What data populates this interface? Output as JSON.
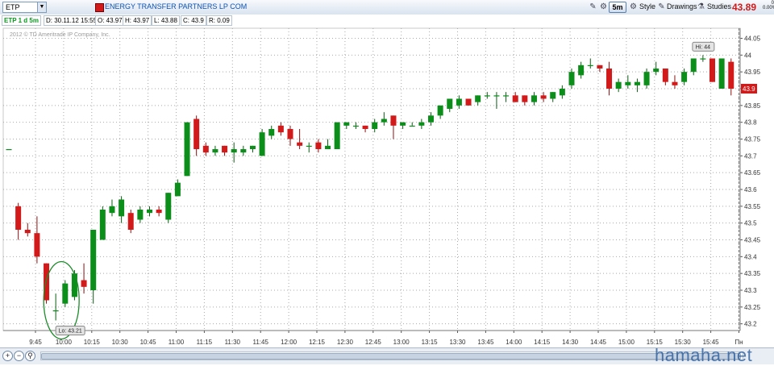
{
  "header": {
    "symbol": "ETP",
    "company": "ENERGY TRANSFER PARTNERS LP COM",
    "interval_label": "5m",
    "style_label": "Style",
    "drawings_label": "Drawings",
    "studies_label": "Studies",
    "last_price": "43.89",
    "change_top": "0",
    "change_pct": "0.00%"
  },
  "infobar": {
    "study": "ETP 1 d 5m",
    "date": "D: 30.11.12 15:55",
    "open": "O: 43.97",
    "high": "H: 43.97",
    "low": "L: 43.88",
    "close": "C: 43.9",
    "range": "R: 0.09"
  },
  "copyright": "2012 © TD Ameritrade IP Company, Inc.",
  "watermark": "hamaha.net",
  "colors": {
    "up": "#0b8e1a",
    "down": "#d21a1a",
    "grid": "#a9a9a9",
    "annotation": "#1c8c2a"
  },
  "chart_data": {
    "type": "candlestick",
    "interval": "5m",
    "y_ticks": [
      "43.2",
      "43.25",
      "43.3",
      "43.35",
      "43.4",
      "43.45",
      "43.5",
      "43.55",
      "43.6",
      "43.65",
      "43.7",
      "43.75",
      "43.8",
      "43.85",
      "43.9",
      "43.95",
      "44",
      "44.05"
    ],
    "ylim": [
      43.18,
      44.08
    ],
    "x_ticks": [
      "9:45",
      "10:00",
      "10:15",
      "10:30",
      "10:45",
      "11:00",
      "11:15",
      "11:30",
      "11:45",
      "12:00",
      "12:15",
      "12:30",
      "12:45",
      "13:00",
      "13:15",
      "13:30",
      "13:45",
      "14:00",
      "14:15",
      "14:30",
      "14:45",
      "15:00",
      "15:15",
      "15:30",
      "15:45",
      "Пн"
    ],
    "last_price_label": "43.9",
    "annotations": {
      "high_label": "Hi: 44",
      "low_label": "Lo: 43.21"
    },
    "candles": [
      {
        "o": 43.72,
        "h": 43.72,
        "l": 43.72,
        "c": 43.72
      },
      {
        "o": 43.55,
        "h": 43.56,
        "l": 43.45,
        "c": 43.48
      },
      {
        "o": 43.48,
        "h": 43.5,
        "l": 43.46,
        "c": 43.47
      },
      {
        "o": 43.47,
        "h": 43.52,
        "l": 43.38,
        "c": 43.4
      },
      {
        "o": 43.38,
        "h": 43.38,
        "l": 43.26,
        "c": 43.27
      },
      {
        "o": 43.24,
        "h": 43.29,
        "l": 43.21,
        "c": 43.24
      },
      {
        "o": 43.26,
        "h": 43.33,
        "l": 43.25,
        "c": 43.32
      },
      {
        "o": 43.28,
        "h": 43.36,
        "l": 43.27,
        "c": 43.35
      },
      {
        "o": 43.33,
        "h": 43.38,
        "l": 43.29,
        "c": 43.31
      },
      {
        "o": 43.3,
        "h": 43.48,
        "l": 43.26,
        "c": 43.48
      },
      {
        "o": 43.45,
        "h": 43.55,
        "l": 43.45,
        "c": 43.54
      },
      {
        "o": 43.53,
        "h": 43.57,
        "l": 43.52,
        "c": 43.55
      },
      {
        "o": 43.52,
        "h": 43.58,
        "l": 43.5,
        "c": 43.57
      },
      {
        "o": 43.53,
        "h": 43.54,
        "l": 43.47,
        "c": 43.48
      },
      {
        "o": 43.51,
        "h": 43.55,
        "l": 43.5,
        "c": 43.54
      },
      {
        "o": 43.53,
        "h": 43.55,
        "l": 43.52,
        "c": 43.54
      },
      {
        "o": 43.54,
        "h": 43.55,
        "l": 43.52,
        "c": 43.53
      },
      {
        "o": 43.51,
        "h": 43.59,
        "l": 43.5,
        "c": 43.59
      },
      {
        "o": 43.58,
        "h": 43.63,
        "l": 43.58,
        "c": 43.62
      },
      {
        "o": 43.64,
        "h": 43.8,
        "l": 43.64,
        "c": 43.8
      },
      {
        "o": 43.81,
        "h": 43.82,
        "l": 43.7,
        "c": 43.72
      },
      {
        "o": 43.73,
        "h": 43.74,
        "l": 43.7,
        "c": 43.71
      },
      {
        "o": 43.71,
        "h": 43.73,
        "l": 43.7,
        "c": 43.72
      },
      {
        "o": 43.73,
        "h": 43.73,
        "l": 43.7,
        "c": 43.71
      },
      {
        "o": 43.71,
        "h": 43.74,
        "l": 43.68,
        "c": 43.72
      },
      {
        "o": 43.71,
        "h": 43.73,
        "l": 43.7,
        "c": 43.72
      },
      {
        "o": 43.72,
        "h": 43.73,
        "l": 43.71,
        "c": 43.73
      },
      {
        "o": 43.7,
        "h": 43.78,
        "l": 43.7,
        "c": 43.77
      },
      {
        "o": 43.76,
        "h": 43.79,
        "l": 43.75,
        "c": 43.78
      },
      {
        "o": 43.79,
        "h": 43.8,
        "l": 43.76,
        "c": 43.77
      },
      {
        "o": 43.78,
        "h": 43.79,
        "l": 43.73,
        "c": 43.75
      },
      {
        "o": 43.74,
        "h": 43.78,
        "l": 43.72,
        "c": 43.73
      },
      {
        "o": 43.73,
        "h": 43.74,
        "l": 43.71,
        "c": 43.73
      },
      {
        "o": 43.74,
        "h": 43.75,
        "l": 43.71,
        "c": 43.72
      },
      {
        "o": 43.72,
        "h": 43.75,
        "l": 43.72,
        "c": 43.73
      },
      {
        "o": 43.72,
        "h": 43.8,
        "l": 43.72,
        "c": 43.8
      },
      {
        "o": 43.79,
        "h": 43.8,
        "l": 43.78,
        "c": 43.8
      },
      {
        "o": 43.79,
        "h": 43.8,
        "l": 43.78,
        "c": 43.79
      },
      {
        "o": 43.79,
        "h": 43.79,
        "l": 43.77,
        "c": 43.78
      },
      {
        "o": 43.78,
        "h": 43.81,
        "l": 43.77,
        "c": 43.8
      },
      {
        "o": 43.8,
        "h": 43.83,
        "l": 43.79,
        "c": 43.81
      },
      {
        "o": 43.82,
        "h": 43.82,
        "l": 43.75,
        "c": 43.79
      },
      {
        "o": 43.79,
        "h": 43.8,
        "l": 43.78,
        "c": 43.8
      },
      {
        "o": 43.79,
        "h": 43.8,
        "l": 43.79,
        "c": 43.79
      },
      {
        "o": 43.79,
        "h": 43.81,
        "l": 43.78,
        "c": 43.8
      },
      {
        "o": 43.8,
        "h": 43.83,
        "l": 43.79,
        "c": 43.82
      },
      {
        "o": 43.82,
        "h": 43.85,
        "l": 43.81,
        "c": 43.85
      },
      {
        "o": 43.84,
        "h": 43.87,
        "l": 43.83,
        "c": 43.87
      },
      {
        "o": 43.85,
        "h": 43.88,
        "l": 43.84,
        "c": 43.87
      },
      {
        "o": 43.87,
        "h": 43.87,
        "l": 43.85,
        "c": 43.85
      },
      {
        "o": 43.86,
        "h": 43.88,
        "l": 43.85,
        "c": 43.88
      },
      {
        "o": 43.88,
        "h": 43.89,
        "l": 43.87,
        "c": 43.88
      },
      {
        "o": 43.88,
        "h": 43.89,
        "l": 43.84,
        "c": 43.88
      },
      {
        "o": 43.88,
        "h": 43.89,
        "l": 43.86,
        "c": 43.88
      },
      {
        "o": 43.88,
        "h": 43.89,
        "l": 43.86,
        "c": 43.86
      },
      {
        "o": 43.88,
        "h": 43.88,
        "l": 43.85,
        "c": 43.86
      },
      {
        "o": 43.86,
        "h": 43.89,
        "l": 43.85,
        "c": 43.88
      },
      {
        "o": 43.88,
        "h": 43.89,
        "l": 43.86,
        "c": 43.87
      },
      {
        "o": 43.87,
        "h": 43.89,
        "l": 43.86,
        "c": 43.89
      },
      {
        "o": 43.88,
        "h": 43.91,
        "l": 43.87,
        "c": 43.9
      },
      {
        "o": 43.91,
        "h": 43.96,
        "l": 43.9,
        "c": 43.95
      },
      {
        "o": 43.94,
        "h": 43.98,
        "l": 43.93,
        "c": 43.97
      },
      {
        "o": 43.97,
        "h": 43.99,
        "l": 43.96,
        "c": 43.97
      },
      {
        "o": 43.97,
        "h": 43.97,
        "l": 43.95,
        "c": 43.96
      },
      {
        "o": 43.96,
        "h": 43.98,
        "l": 43.88,
        "c": 43.9
      },
      {
        "o": 43.9,
        "h": 43.93,
        "l": 43.89,
        "c": 43.92
      },
      {
        "o": 43.91,
        "h": 43.94,
        "l": 43.9,
        "c": 43.92
      },
      {
        "o": 43.91,
        "h": 43.93,
        "l": 43.89,
        "c": 43.92
      },
      {
        "o": 43.91,
        "h": 43.96,
        "l": 43.9,
        "c": 43.95
      },
      {
        "o": 43.95,
        "h": 43.98,
        "l": 43.94,
        "c": 43.96
      },
      {
        "o": 43.96,
        "h": 43.96,
        "l": 43.91,
        "c": 43.92
      },
      {
        "o": 43.92,
        "h": 43.94,
        "l": 43.9,
        "c": 43.91
      },
      {
        "o": 43.92,
        "h": 43.96,
        "l": 43.91,
        "c": 43.95
      },
      {
        "o": 43.95,
        "h": 43.99,
        "l": 43.94,
        "c": 43.99
      },
      {
        "o": 43.99,
        "h": 44.0,
        "l": 43.98,
        "c": 43.99
      },
      {
        "o": 43.99,
        "h": 43.99,
        "l": 43.92,
        "c": 43.92
      },
      {
        "o": 43.9,
        "h": 43.99,
        "l": 43.9,
        "c": 43.99
      },
      {
        "o": 43.98,
        "h": 43.99,
        "l": 43.88,
        "c": 43.9
      }
    ]
  }
}
